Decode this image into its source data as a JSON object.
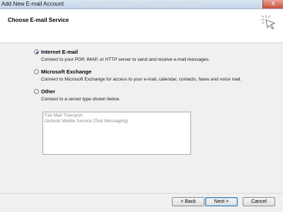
{
  "window": {
    "title": "Add New E-mail Account",
    "close_label": "X"
  },
  "header": {
    "title": "Choose E-mail Service",
    "icon": "wizard-sparkle-icon"
  },
  "options": [
    {
      "label": "Internet E-mail",
      "description": "Connect to your POP, IMAP, or HTTP server to send and receive e-mail messages.",
      "checked": true
    },
    {
      "label": "Microsoft Exchange",
      "description": "Connect to Microsoft Exchange for access to your e-mail, calendar, contacts, faxes and voice mail.",
      "checked": false
    },
    {
      "label": "Other",
      "description": "Connect to a server type shown below.",
      "checked": false
    }
  ],
  "server_types": [
    "Fax Mail Transport",
    "Outlook Mobile Service (Text Messaging)"
  ],
  "buttons": {
    "back": "< Back",
    "next": "Next >",
    "cancel": "Cancel"
  },
  "colors": {
    "accent": "#2a5db0",
    "title_bar": "#c2d3e7"
  }
}
